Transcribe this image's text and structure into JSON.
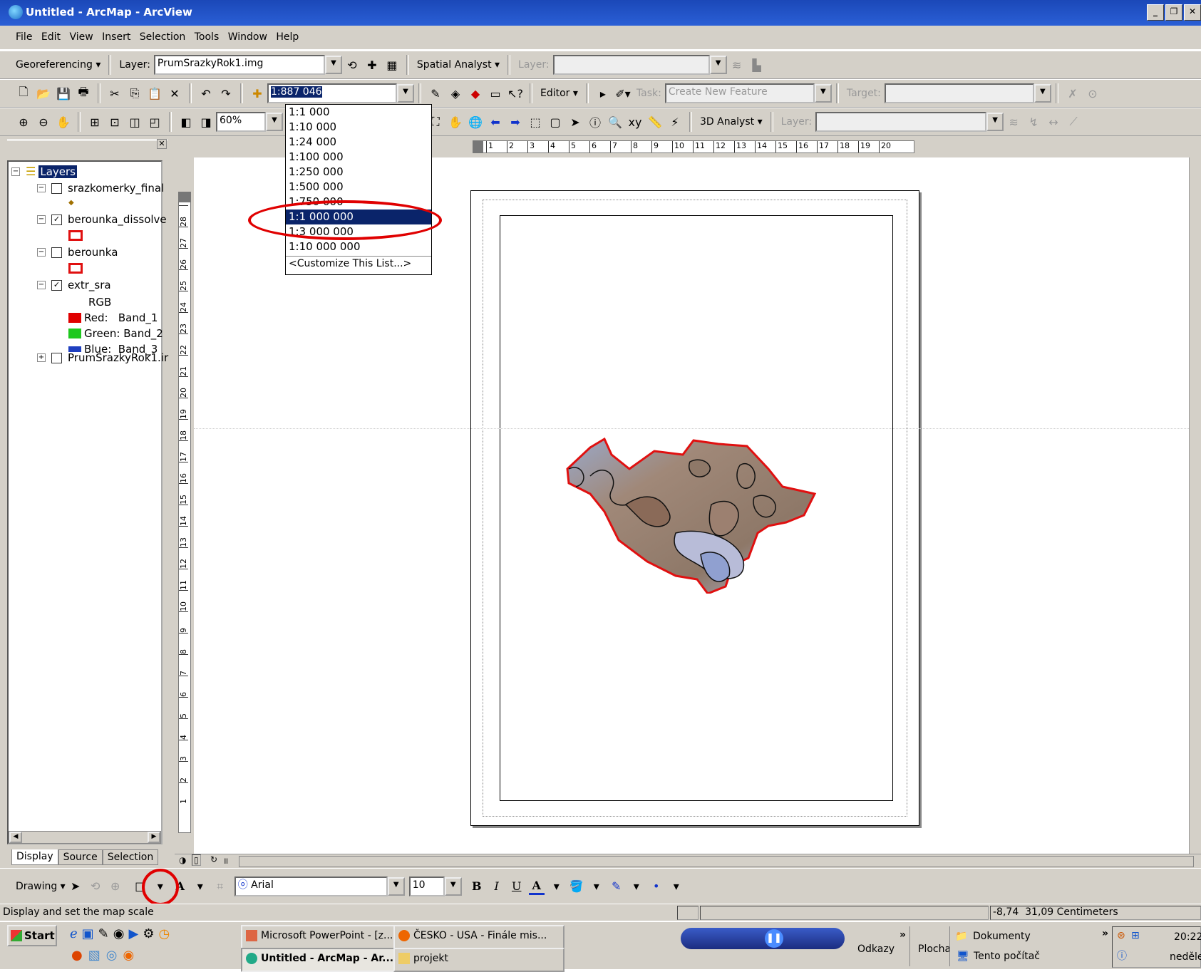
{
  "window": {
    "title": "Untitled - ArcMap - ArcView"
  },
  "menu": [
    "File",
    "Edit",
    "View",
    "Insert",
    "Selection",
    "Tools",
    "Window",
    "Help"
  ],
  "toolbar1": {
    "georef_label": "Georeferencing",
    "layer_label": "Layer:",
    "layer_value": "PrumSrazkyRok1.img",
    "spatial_label": "Spatial Analyst",
    "spatial_layer_label": "Layer:"
  },
  "toolbar2": {
    "scale_value": "1:887 046",
    "editor_label": "Editor",
    "task_label": "Task:",
    "task_value": "Create New Feature",
    "target_label": "Target:"
  },
  "toolbar3": {
    "zoom_value": "60%",
    "analyst3d_label": "3D Analyst",
    "layer_label": "Layer:"
  },
  "scale_dropdown": {
    "options": [
      "1:1 000",
      "1:10 000",
      "1:24 000",
      "1:100 000",
      "1:250 000",
      "1:500 000",
      "1:750 000",
      "1:1 000 000",
      "1:3 000 000",
      "1:10 000 000"
    ],
    "selected": "1:1 000 000",
    "customize": "<Customize This List...>"
  },
  "toc": {
    "root": "Layers",
    "layers": [
      {
        "name": "srazkomerky_final",
        "checked": false
      },
      {
        "name": "berounka_dissolve",
        "checked": true
      },
      {
        "name": "berounka",
        "checked": false
      },
      {
        "name": "extr_sra",
        "checked": true
      },
      {
        "name": "PrumSrazkyRok1.ir",
        "checked": false
      }
    ],
    "rgb_label": "RGB",
    "bands": [
      {
        "label": "Red:   Band_1",
        "color": "#e00000"
      },
      {
        "label": "Green: Band_2",
        "color": "#1ec81e"
      },
      {
        "label": "Blue:  Band_3",
        "color": "#1f3fc0"
      }
    ],
    "tabs": [
      "Display",
      "Source",
      "Selection"
    ]
  },
  "rulers": {
    "top": [
      "1",
      "2",
      "3",
      "4",
      "5",
      "6",
      "7",
      "8",
      "9",
      "10",
      "11",
      "12",
      "13",
      "14",
      "15",
      "16",
      "17",
      "18",
      "19",
      "20"
    ],
    "left": [
      "28",
      "27",
      "26",
      "25",
      "24",
      "23",
      "22",
      "21",
      "20",
      "19",
      "18",
      "17",
      "16",
      "15",
      "14",
      "13",
      "12",
      "11",
      "10",
      "9",
      "8",
      "7",
      "6",
      "5",
      "4",
      "3",
      "2",
      "1"
    ]
  },
  "drawing_toolbar": {
    "drawing_label": "Drawing",
    "font_value": "Arial",
    "size_value": "10",
    "bold": "B",
    "italic": "I",
    "underline": "U",
    "font_color": "A"
  },
  "status": {
    "message": "Display and set the map scale",
    "coords": "-8,74  31,09 Centimeters"
  },
  "taskbar": {
    "start": "Start",
    "powerpoint": "Microsoft PowerPoint - [z...",
    "cesko": "ČESKO - USA - Finále mis...",
    "arcmap": "Untitled - ArcMap - Ar...",
    "projekt": "projekt",
    "odkazy": "Odkazy",
    "plocha": "Plocha",
    "dokumenty": "Dokumenty",
    "tento": "Tento počítač",
    "time": "20:22",
    "day": "neděle"
  },
  "colors": {
    "titlebar": "#2a5fd6",
    "selection": "#0a246a",
    "annotation_red": "#e00000",
    "boundary": "#e01010"
  }
}
